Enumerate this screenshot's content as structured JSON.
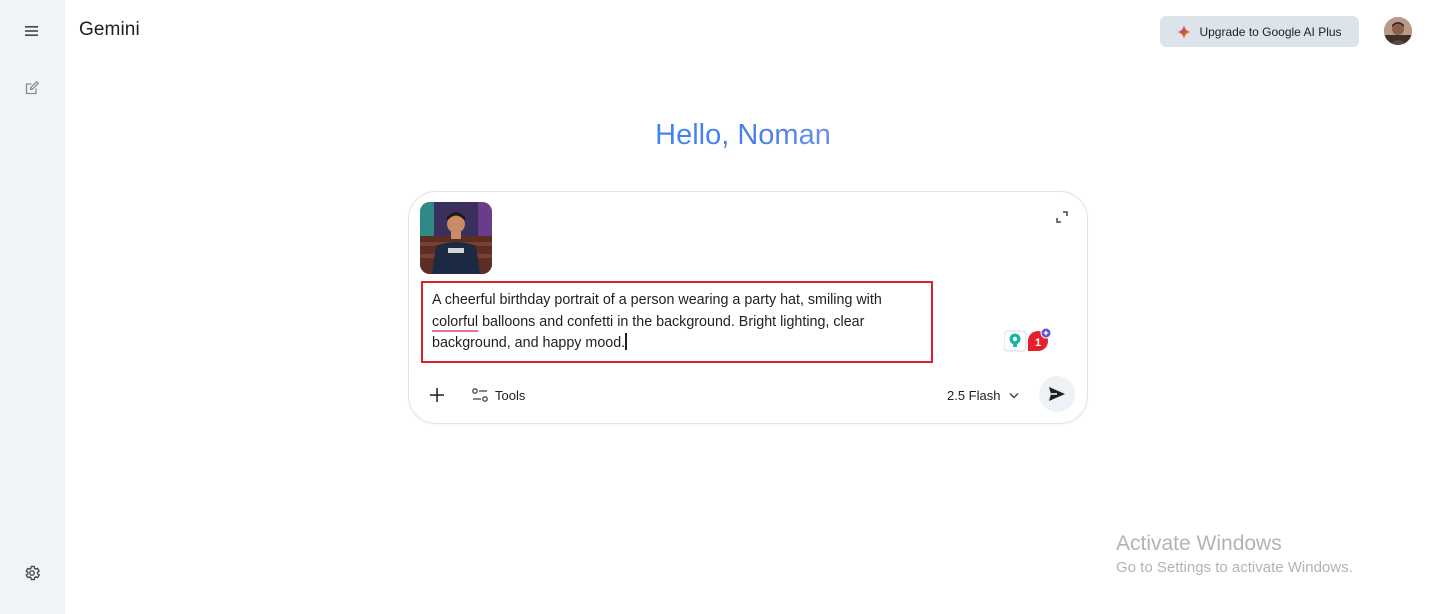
{
  "app": {
    "title": "Gemini"
  },
  "sidebar": {
    "menu_icon": "menu-icon",
    "new_chat_icon": "edit-icon",
    "settings_icon": "gear-icon"
  },
  "header": {
    "upgrade_label": "Upgrade to Google AI Plus",
    "upgrade_icon": "sparkle-icon"
  },
  "greeting": {
    "text": "Hello, Noman"
  },
  "prompt": {
    "text_before": "A cheerful birthday portrait of a person wearing a party hat, smiling with ",
    "underlined_word": "colorful",
    "text_after": " balloons and confetti in the background. Bright lighting, clear background, and happy mood.",
    "extension_badge": "1"
  },
  "toolbar": {
    "tools_label": "Tools",
    "model_label": "2.5 Flash"
  },
  "watermark": {
    "title": "Activate Windows",
    "subtitle": "Go to Settings to activate Windows."
  },
  "colors": {
    "sidebar_bg": "#f0f4f9",
    "greeting_blue": "#4285f4",
    "highlight_border": "#d9202d",
    "upgrade_bg": "#dde3ea"
  }
}
